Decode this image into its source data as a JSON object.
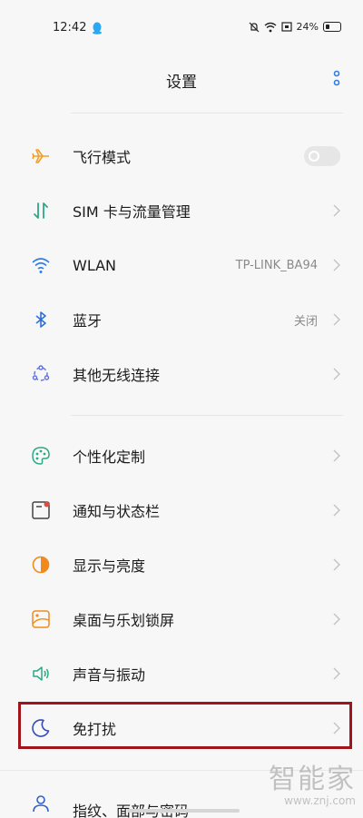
{
  "status_bar": {
    "time": "12:42",
    "battery": "24%"
  },
  "header": {
    "title": "设置"
  },
  "group1": [
    {
      "label": "飞行模式",
      "icon": "airplane-icon",
      "control": "toggle",
      "toggle_on": false
    },
    {
      "label": "SIM 卡与流量管理",
      "icon": "sim-data-icon"
    },
    {
      "label": "WLAN",
      "value": "TP-LINK_BA94",
      "icon": "wifi-icon"
    },
    {
      "label": "蓝牙",
      "value": "关闭",
      "icon": "bluetooth-icon"
    },
    {
      "label": "其他无线连接",
      "icon": "wireless-connections-icon"
    }
  ],
  "group2": [
    {
      "label": "个性化定制",
      "icon": "palette-icon"
    },
    {
      "label": "通知与状态栏",
      "icon": "notification-icon"
    },
    {
      "label": "显示与亮度",
      "icon": "display-brightness-icon"
    },
    {
      "label": "桌面与乐划锁屏",
      "icon": "wallpaper-icon"
    },
    {
      "label": "声音与振动",
      "icon": "sound-icon"
    },
    {
      "label": "免打扰",
      "icon": "moon-icon"
    }
  ],
  "group3": [
    {
      "label": "指纹、面部与密码",
      "icon": "user-lock-icon"
    }
  ],
  "watermark": {
    "brand": "智能家",
    "url": "www.znj.com"
  },
  "colors": {
    "highlight": "#a0151a",
    "airplane": "#f0a02a",
    "sim": "#2aaa82",
    "wifi": "#2f7ee6",
    "bluetooth": "#2f6fd6"
  }
}
